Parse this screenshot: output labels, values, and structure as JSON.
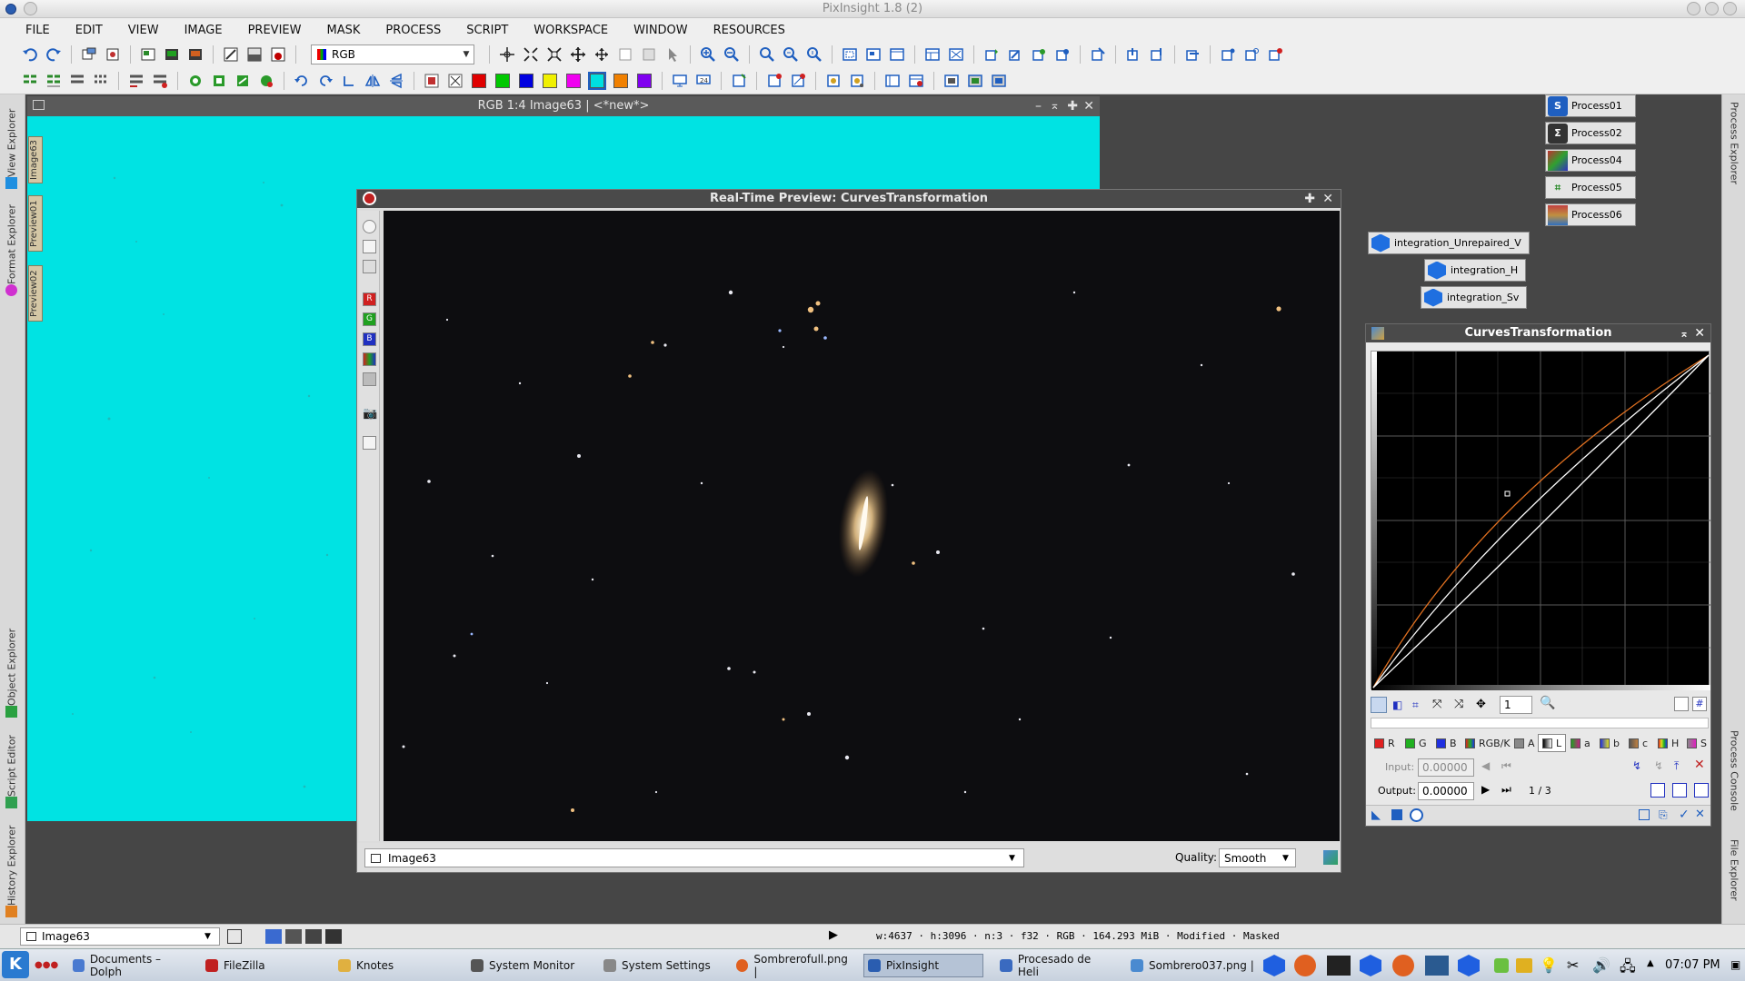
{
  "window": {
    "title": "PixInsight 1.8 (2)"
  },
  "menu": [
    "FILE",
    "EDIT",
    "VIEW",
    "IMAGE",
    "PREVIEW",
    "MASK",
    "PROCESS",
    "SCRIPT",
    "WORKSPACE",
    "WINDOW",
    "RESOURCES"
  ],
  "toolbar": {
    "rgb_select": "RGB"
  },
  "left_tabs": {
    "view_explorer": "View Explorer",
    "format_explorer": "Format Explorer",
    "object_explorer": "Object Explorer",
    "script_editor": "Script Editor",
    "history_explorer": "History Explorer"
  },
  "image_window": {
    "title": "RGB 1:4 Image63 | <*new*>",
    "tabs": [
      "Image63",
      "Preview01",
      "Preview02"
    ]
  },
  "rtp": {
    "title": "Real-Time Preview: CurvesTransformation",
    "view_select": "Image63",
    "quality_label": "Quality:",
    "quality_value": "Smooth",
    "side_labels": [
      "R",
      "G",
      "B"
    ]
  },
  "process_icons": [
    "Process01",
    "Process02",
    "Process04",
    "Process05",
    "Process06"
  ],
  "integration_icons": [
    "integration_Unrepaired_V",
    "integration_H",
    "integration_Sv"
  ],
  "right_tabs": {
    "process_explorer": "Process Explorer",
    "process_console": "Process Console",
    "file_explorer": "File Explorer"
  },
  "curves": {
    "title": "CurvesTransformation",
    "zoom": "1",
    "channels": [
      "R",
      "G",
      "B",
      "RGB/K",
      "A",
      "L",
      "a",
      "b",
      "c",
      "H",
      "S"
    ],
    "selected_channel": "L",
    "input_label": "Input:",
    "input_value": "0.00000",
    "output_label": "Output:",
    "output_value": "0.00000",
    "point_counter": "1 / 3"
  },
  "status": {
    "view": "Image63",
    "info": "w:4637 · h:3096 · n:3 · f32 · RGB · 164.293 MiB · Modified · Masked"
  },
  "taskbar": {
    "items": [
      "Documents – Dolph",
      "FileZilla",
      "Knotes",
      "System Monitor",
      "System Settings",
      "Sombrerofull.png |",
      "PixInsight",
      "Procesado de Heli",
      "Sombrero037.png |"
    ],
    "active": "PixInsight",
    "clock": "07:07 PM"
  },
  "colors": {
    "accent": "#00e3e3",
    "curve_rgb": "#ffffff",
    "curve_red": "#e07020"
  }
}
